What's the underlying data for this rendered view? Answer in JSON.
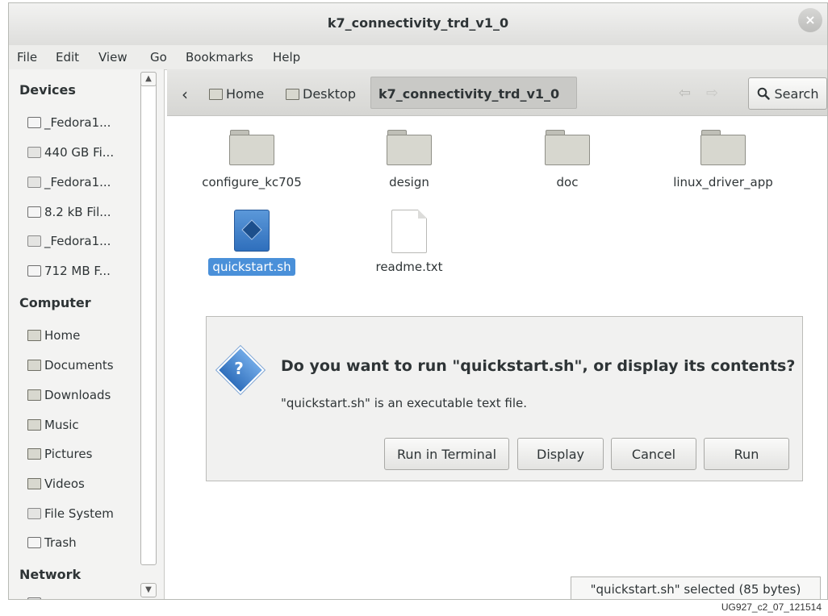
{
  "window": {
    "title": "k7_connectivity_trd_v1_0",
    "close_label": "×"
  },
  "menu": [
    "File",
    "Edit",
    "View",
    "Go",
    "Bookmarks",
    "Help"
  ],
  "sidebar": {
    "devices_heading": "Devices",
    "devices": [
      "_Fedora1...",
      "440 GB Fi...",
      "_Fedora1...",
      "8.2 kB Fil...",
      "_Fedora1...",
      "712 MB F..."
    ],
    "computer_heading": "Computer",
    "computer": [
      "Home",
      "Documents",
      "Downloads",
      "Music",
      "Pictures",
      "Videos",
      "File System",
      "Trash"
    ],
    "network_heading": "Network"
  },
  "toolbar": {
    "back": "‹",
    "crumbs": [
      "Home",
      "Desktop",
      "k7_connectivity_trd_v1_0"
    ],
    "search_label": "Search"
  },
  "files": [
    {
      "name": "configure_kc705",
      "type": "folder"
    },
    {
      "name": "design",
      "type": "folder"
    },
    {
      "name": "doc",
      "type": "folder"
    },
    {
      "name": "linux_driver_app",
      "type": "folder"
    },
    {
      "name": "quickstart.sh",
      "type": "script",
      "selected": true
    },
    {
      "name": "readme.txt",
      "type": "text"
    }
  ],
  "dialog": {
    "icon": "?",
    "title": "Do you want to run \"quickstart.sh\", or display its contents?",
    "subtitle": "\"quickstart.sh\" is an executable text file.",
    "buttons": [
      "Run in Terminal",
      "Display",
      "Cancel",
      "Run"
    ]
  },
  "status": "\"quickstart.sh\" selected (85 bytes)",
  "caption": "UG927_c2_07_121514",
  "colors": {
    "selection": "#4a90d9",
    "window_bg": "#ffffff",
    "toolbar_bg": "#dcdcd9"
  }
}
